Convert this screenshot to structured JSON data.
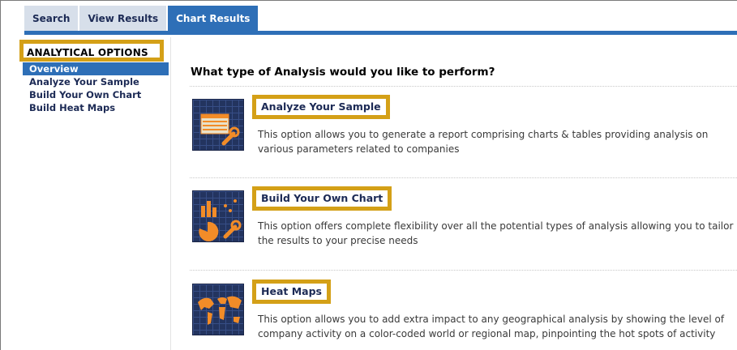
{
  "tabs": [
    {
      "label": "Search"
    },
    {
      "label": "View Results"
    },
    {
      "label": "Chart Results",
      "active": true
    }
  ],
  "sidebar": {
    "title": "ANALYTICAL OPTIONS",
    "items": [
      {
        "label": "Overview",
        "active": true
      },
      {
        "label": "Analyze Your Sample"
      },
      {
        "label": "Build Your Own Chart"
      },
      {
        "label": "Build Heat Maps"
      }
    ]
  },
  "main": {
    "heading": "What type of Analysis would you like to perform?",
    "options": [
      {
        "title": "Analyze Your Sample",
        "description": "This option allows you to generate a report comprising charts & tables providing analysis on various parameters related to companies",
        "icon": "report-table-wrench-icon"
      },
      {
        "title": "Build Your Own Chart",
        "description": "This option offers complete flexibility over all the potential types of analysis allowing you to tailor the results to your precise needs",
        "icon": "chart-builder-icon"
      },
      {
        "title": "Heat Maps",
        "description": "This option allows you to add extra impact to any geographical analysis by showing the level of company activity on a color-coded world or regional map, pinpointing the hot spots of activity",
        "icon": "world-map-icon"
      }
    ]
  },
  "colors": {
    "accent_blue": "#2e6fb7",
    "highlight_gold": "#d4a017",
    "navy_text": "#1c2a55",
    "icon_orange": "#f28c28"
  }
}
